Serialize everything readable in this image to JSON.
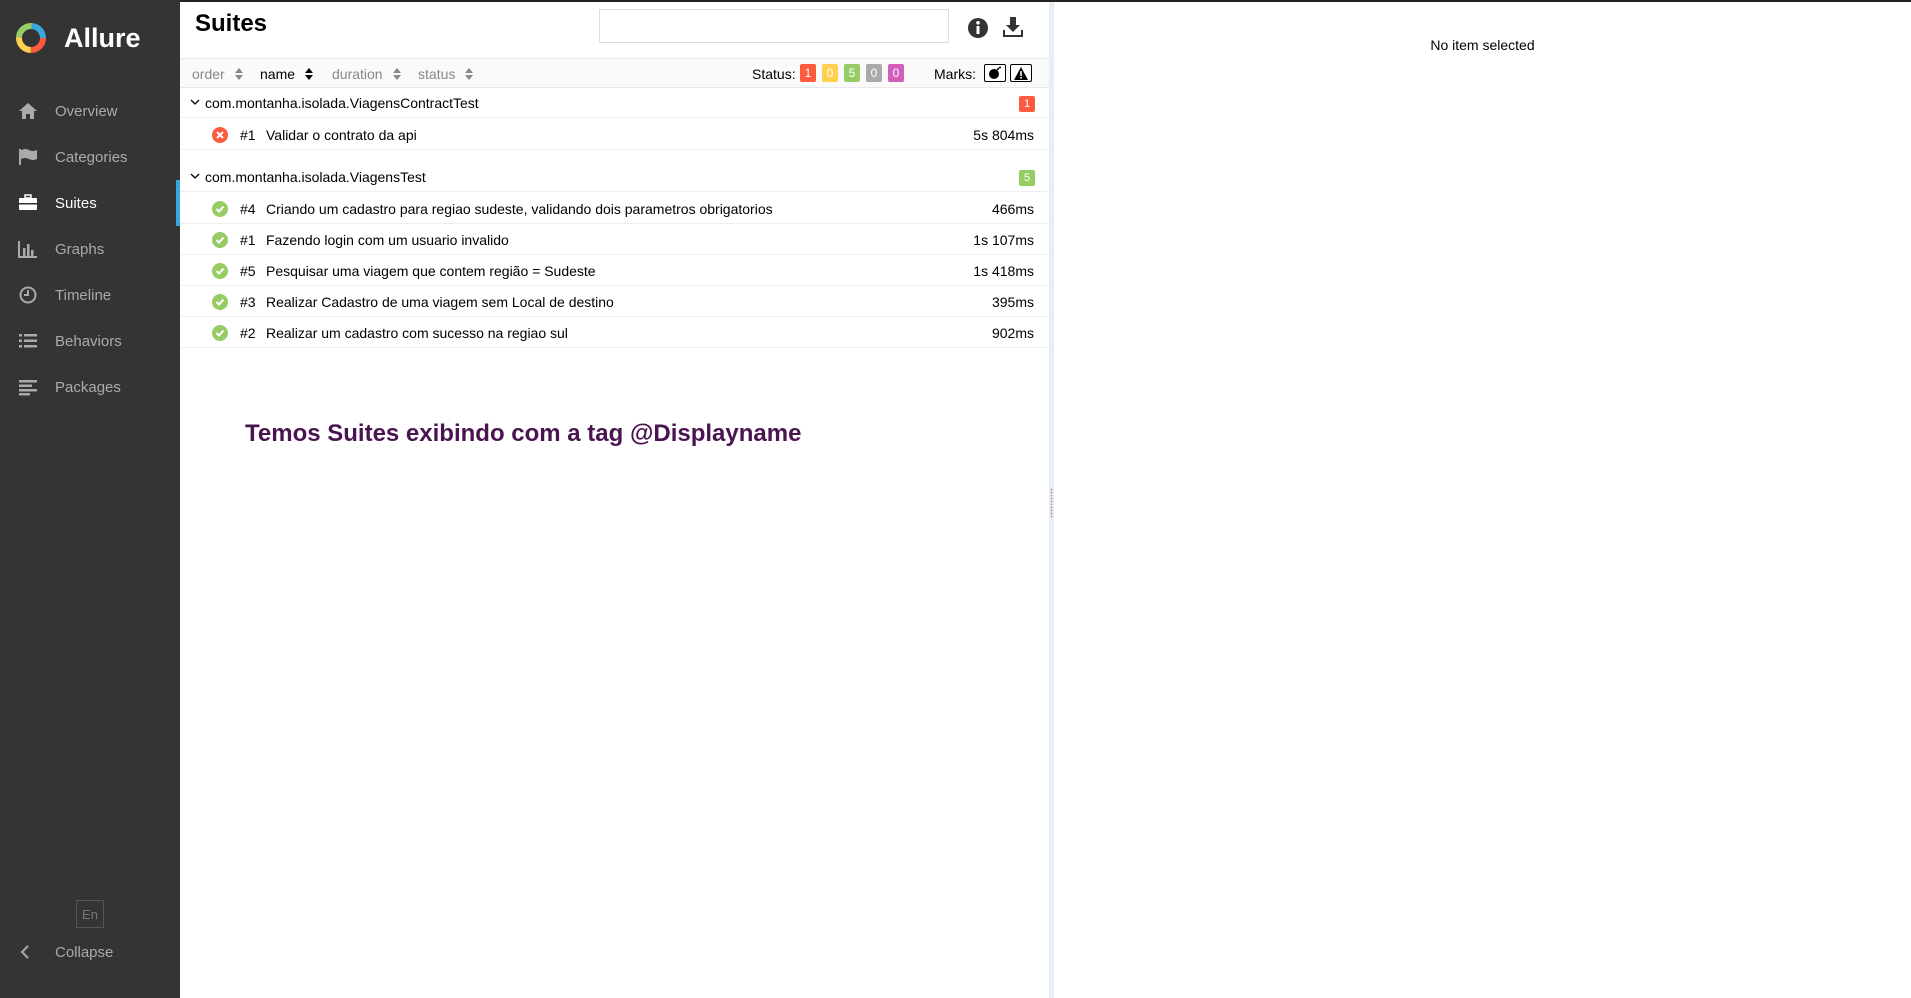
{
  "app": {
    "name": "Allure"
  },
  "sidebar": {
    "items": [
      {
        "label": "Overview",
        "icon": "home-icon",
        "active": false
      },
      {
        "label": "Categories",
        "icon": "flag-icon",
        "active": false
      },
      {
        "label": "Suites",
        "icon": "briefcase-icon",
        "active": true
      },
      {
        "label": "Graphs",
        "icon": "bar-chart-icon",
        "active": false
      },
      {
        "label": "Timeline",
        "icon": "clock-icon",
        "active": false
      },
      {
        "label": "Behaviors",
        "icon": "list-icon",
        "active": false
      },
      {
        "label": "Packages",
        "icon": "align-left-icon",
        "active": false
      }
    ],
    "language": "En",
    "collapse_label": "Collapse"
  },
  "page": {
    "title": "Suites",
    "search_value": ""
  },
  "toolbar": {
    "sort_columns": [
      "order",
      "name",
      "duration",
      "status"
    ],
    "active_sort": "name",
    "status_label": "Status:",
    "status_counts": [
      {
        "value": "1",
        "color": "#fd5a3e",
        "status": "failed"
      },
      {
        "value": "0",
        "color": "#ffd050",
        "status": "broken"
      },
      {
        "value": "5",
        "color": "#97cc64",
        "status": "passed"
      },
      {
        "value": "0",
        "color": "#aaaaaa",
        "status": "skipped"
      },
      {
        "value": "0",
        "color": "#d35ebe",
        "status": "unknown"
      }
    ],
    "marks_label": "Marks:",
    "marks": [
      "flaky-bomb-icon",
      "warning-icon"
    ]
  },
  "suites": [
    {
      "name": "com.montanha.isolada.ViagensContractTest",
      "count": "1",
      "count_color": "#fd5a3e",
      "tests": [
        {
          "num": "#1",
          "name": "Validar o contrato da api",
          "duration": "5s 804ms",
          "status": "failed"
        }
      ]
    },
    {
      "name": "com.montanha.isolada.ViagensTest",
      "count": "5",
      "count_color": "#97cc64",
      "tests": [
        {
          "num": "#4",
          "name": "Criando um cadastro para regiao sudeste, validando dois parametros obrigatorios",
          "duration": "466ms",
          "status": "passed"
        },
        {
          "num": "#1",
          "name": "Fazendo login com um usuario invalido",
          "duration": "1s 107ms",
          "status": "passed"
        },
        {
          "num": "#5",
          "name": "Pesquisar uma viagem que contem região = Sudeste",
          "duration": "1s 418ms",
          "status": "passed"
        },
        {
          "num": "#3",
          "name": "Realizar Cadastro de uma viagem sem Local de destino",
          "duration": "395ms",
          "status": "passed"
        },
        {
          "num": "#2",
          "name": "Realizar um cadastro com sucesso na regiao sul",
          "duration": "902ms",
          "status": "passed"
        }
      ]
    }
  ],
  "annotation": "Temos Suites exibindo com a tag @Displayname",
  "detail": {
    "empty_text": "No item selected"
  },
  "colors": {
    "sidebar_bg": "#343434",
    "accent": "#38a7d9",
    "failed": "#fd5a3e",
    "passed": "#97cc64",
    "annotation": "#4a1450"
  }
}
